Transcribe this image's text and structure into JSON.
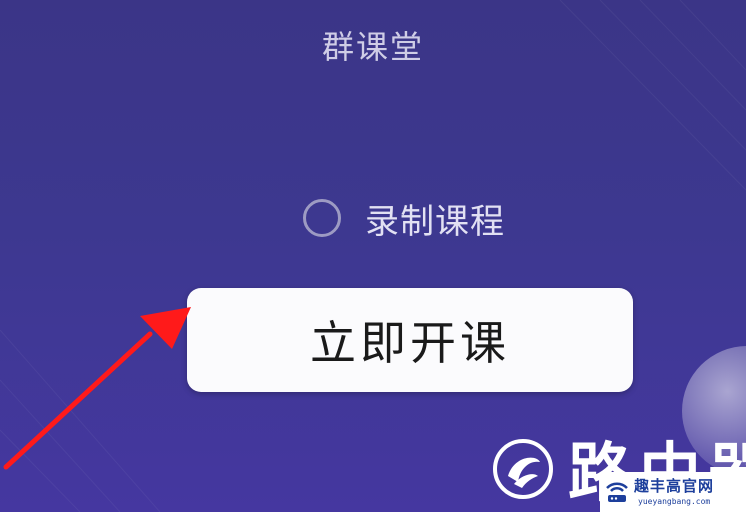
{
  "header": {
    "title": "群课堂"
  },
  "options": {
    "record_label": "录制课程",
    "record_checked": false
  },
  "actions": {
    "start_label": "立即开课"
  },
  "watermark": {
    "site_chars": "路由器",
    "badge_text": "趣丰高官网",
    "badge_url": "yueyangbang.com"
  },
  "colors": {
    "background_top": "#3b3587",
    "background_bottom": "#4537a0",
    "button_bg": "#fbfbfd",
    "arrow": "#ff1a1a",
    "badge_text": "#1d3f9c"
  },
  "icons": {
    "annotation": "red-arrow-icon",
    "radio": "radio-unchecked-icon",
    "watermark_logo": "swirl-logo-icon",
    "badge_logo": "wifi-router-icon"
  }
}
